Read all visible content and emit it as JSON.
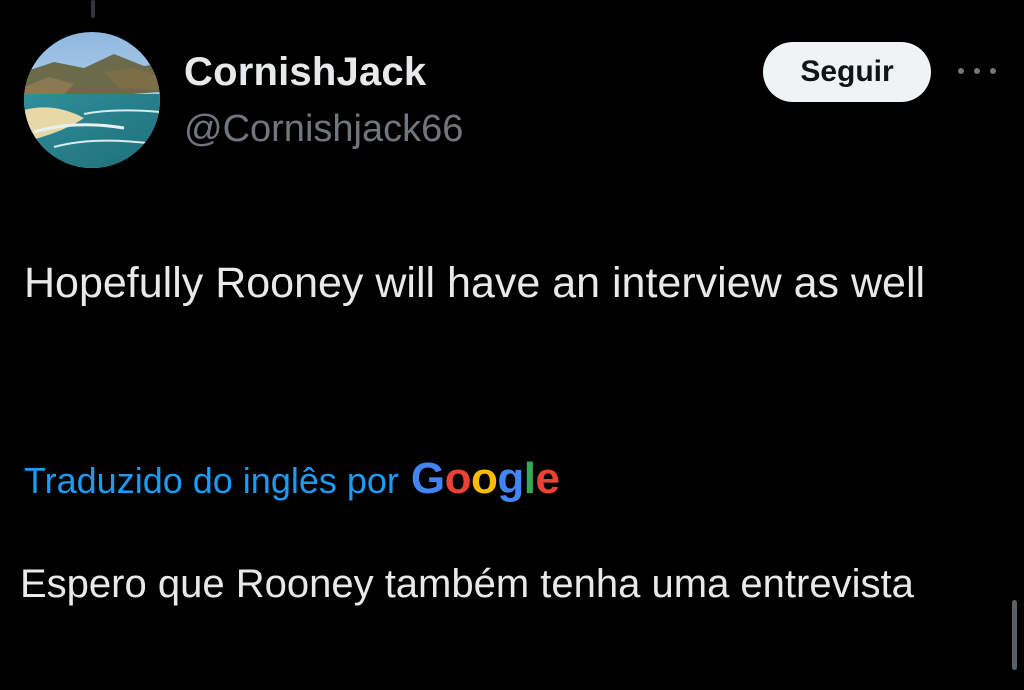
{
  "author": {
    "display_name": "CornishJack",
    "handle": "@Cornishjack66",
    "avatar_icon": "beach-landscape-avatar"
  },
  "follow_button": {
    "label": "Seguir"
  },
  "more_icon": "ellipsis-icon",
  "tweet": {
    "text": "Hopefully Rooney will have an interview as well"
  },
  "translation": {
    "attribution": "Traduzido do inglês por",
    "provider": {
      "letters": [
        "G",
        "o",
        "o",
        "g",
        "l",
        "e"
      ],
      "colors": [
        "#4285f4",
        "#ea4335",
        "#fbbc05",
        "#4285f4",
        "#34a853",
        "#ea4335"
      ]
    },
    "text": "Espero que Rooney também tenha uma entrevista"
  },
  "colors": {
    "background": "#000000",
    "text": "#e7e9ea",
    "secondary": "#71767b",
    "link": "#1d9bf0",
    "button_bg": "#eff3f4"
  }
}
